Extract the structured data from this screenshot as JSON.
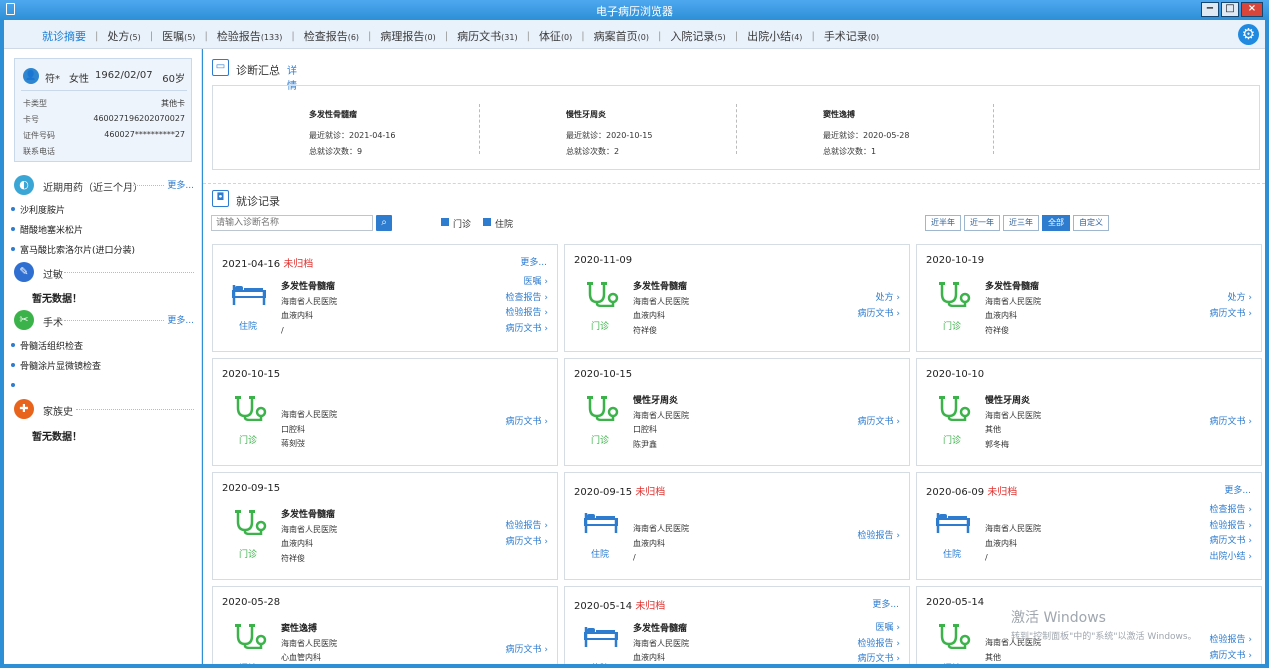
{
  "window": {
    "title": "电子病历浏览器"
  },
  "nav": {
    "tabs": [
      {
        "label": "就诊摘要",
        "count": ""
      },
      {
        "label": "处方",
        "count": "(5)"
      },
      {
        "label": "医嘱",
        "count": "(5)"
      },
      {
        "label": "检验报告",
        "count": "(133)"
      },
      {
        "label": "检查报告",
        "count": "(6)"
      },
      {
        "label": "病理报告",
        "count": "(0)"
      },
      {
        "label": "病历文书",
        "count": "(31)"
      },
      {
        "label": "体征",
        "count": "(0)"
      },
      {
        "label": "病案首页",
        "count": "(0)"
      },
      {
        "label": "入院记录",
        "count": "(5)"
      },
      {
        "label": "出院小结",
        "count": "(4)"
      },
      {
        "label": "手术记录",
        "count": "(0)"
      }
    ],
    "separator": "|",
    "active_color": "#1a7fd6"
  },
  "patient": {
    "name": "符*",
    "gender": "女性",
    "dob": "1962/02/07",
    "age": "60岁",
    "fields": [
      {
        "label": "卡类型",
        "value": "其他卡"
      },
      {
        "label": "卡号",
        "value": "460027196202070027"
      },
      {
        "label": "证件号码",
        "value": "460027**********27"
      },
      {
        "label": "联系电话",
        "value": ""
      }
    ]
  },
  "sidebar": {
    "meds": {
      "title": "近期用药（近三个月）",
      "more": "更多...",
      "items": [
        "沙利度胺片",
        "醋酸地塞米松片",
        "富马酸比索洛尔片(进口分装)"
      ]
    },
    "allergy": {
      "title": "过敏",
      "empty": "暂无数据！"
    },
    "surgery": {
      "title": "手术",
      "more": "更多...",
      "items": [
        "骨髓活组织检查",
        "骨髓涂片显微镜检查",
        ""
      ]
    },
    "family": {
      "title": "家族史",
      "empty": "暂无数据！"
    }
  },
  "diagnosis": {
    "title": "诊断汇总",
    "detail_link": "详情",
    "items": [
      {
        "name": "多发性骨髓瘤",
        "recent": "最近就诊：2021-04-16",
        "count": "总就诊次数：9"
      },
      {
        "name": "慢性牙周炎",
        "recent": "最近就诊：2020-10-15",
        "count": "总就诊次数：2"
      },
      {
        "name": "窦性逸搏",
        "recent": "最近就诊：2020-05-28",
        "count": "总就诊次数：1"
      }
    ]
  },
  "visits": {
    "title": "就诊记录",
    "search_placeholder": "请输入诊断名称",
    "legend": [
      "门诊",
      "住院"
    ],
    "ranges": [
      "近半年",
      "近一年",
      "近三年",
      "全部",
      "自定义"
    ],
    "active_range": "全部",
    "cards": [
      {
        "date": "2021-04-16",
        "unarchived": "未归档",
        "more": "更多...",
        "type": "住院",
        "dx": "多发性骨髓瘤",
        "hospital": "海南省人民医院",
        "dept": "血液内科",
        "doctor": "/",
        "links": [
          "医嘱 ›",
          "检查报告 ›",
          "检验报告 ›",
          "病历文书 ›"
        ]
      },
      {
        "date": "2020-11-09",
        "unarchived": "",
        "more": "",
        "type": "门诊",
        "dx": "多发性骨髓瘤",
        "hospital": "海南省人民医院",
        "dept": "血液内科",
        "doctor": "符祥俊",
        "links": [
          "处方 ›",
          "病历文书 ›"
        ]
      },
      {
        "date": "2020-10-19",
        "unarchived": "",
        "more": "",
        "type": "门诊",
        "dx": "多发性骨髓瘤",
        "hospital": "海南省人民医院",
        "dept": "血液内科",
        "doctor": "符祥俊",
        "links": [
          "处方 ›",
          "病历文书 ›"
        ]
      },
      {
        "date": "2020-10-15",
        "unarchived": "",
        "more": "",
        "type": "门诊",
        "dx": "",
        "hospital": "海南省人民医院",
        "dept": "口腔科",
        "doctor": "蒋刻弢",
        "links": [
          "病历文书 ›"
        ]
      },
      {
        "date": "2020-10-15",
        "unarchived": "",
        "more": "",
        "type": "门诊",
        "dx": "慢性牙周炎",
        "hospital": "海南省人民医院",
        "dept": "口腔科",
        "doctor": "陈尹鑫",
        "links": [
          "病历文书 ›"
        ]
      },
      {
        "date": "2020-10-10",
        "unarchived": "",
        "more": "",
        "type": "门诊",
        "dx": "慢性牙周炎",
        "hospital": "海南省人民医院",
        "dept": "其他",
        "doctor": "郭冬梅",
        "links": [
          "病历文书 ›"
        ]
      },
      {
        "date": "2020-09-15",
        "unarchived": "",
        "more": "",
        "type": "门诊",
        "dx": "多发性骨髓瘤",
        "hospital": "海南省人民医院",
        "dept": "血液内科",
        "doctor": "符祥俊",
        "links": [
          "检验报告 ›",
          "病历文书 ›"
        ]
      },
      {
        "date": "2020-09-15",
        "unarchived": "未归档",
        "more": "",
        "type": "住院",
        "dx": "",
        "hospital": "海南省人民医院",
        "dept": "血液内科",
        "doctor": "/",
        "links": [
          "检验报告 ›"
        ]
      },
      {
        "date": "2020-06-09",
        "unarchived": "未归档",
        "more": "更多...",
        "type": "住院",
        "dx": "",
        "hospital": "海南省人民医院",
        "dept": "血液内科",
        "doctor": "/",
        "links": [
          "检查报告 ›",
          "检验报告 ›",
          "病历文书 ›",
          "出院小结 ›"
        ]
      },
      {
        "date": "2020-05-28",
        "unarchived": "",
        "more": "",
        "type": "门诊",
        "dx": "窦性逸搏",
        "hospital": "海南省人民医院",
        "dept": "心血管内科",
        "doctor": "",
        "links": [
          "病历文书 ›"
        ]
      },
      {
        "date": "2020-05-14",
        "unarchived": "未归档",
        "more": "更多...",
        "type": "住院",
        "dx": "多发性骨髓瘤",
        "hospital": "海南省人民医院",
        "dept": "血液内科",
        "doctor": "",
        "links": [
          "医嘱 ›",
          "检验报告 ›",
          "病历文书 ›"
        ]
      },
      {
        "date": "2020-05-14",
        "unarchived": "",
        "more": "",
        "type": "门诊",
        "dx": "",
        "hospital": "海南省人民医院",
        "dept": "其他",
        "doctor": "",
        "links": [
          "检验报告 ›",
          "病历文书 ›"
        ]
      }
    ]
  },
  "watermark": {
    "line1": "激活 Windows",
    "line2": "转到\"控制面板\"中的\"系统\"以激活 Windows。"
  },
  "colors": {
    "accent": "#2d7cd0",
    "outpatient": "#3bb34a",
    "unarchived": "#e0322f",
    "titlebar": "#2d8fd6"
  },
  "icons": {
    "settings": "gear-icon",
    "outpatient": "stethoscope-icon",
    "inpatient": "hospital-bed-icon"
  }
}
